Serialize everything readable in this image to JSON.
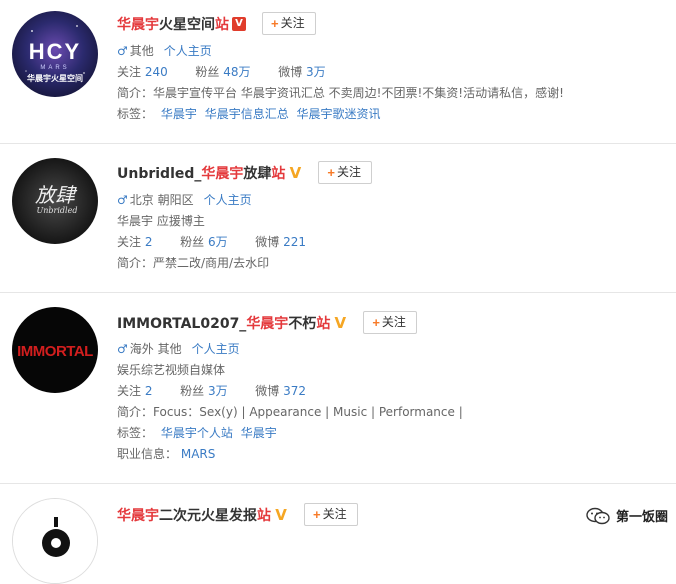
{
  "users": [
    {
      "name_prefix": "华晨宇",
      "name_middle": "火星空间",
      "name_suffix": "站",
      "verified": "red",
      "follow_label": "关注",
      "location": "其他",
      "home_link": "个人主页",
      "stats": {
        "follow_label": "关注",
        "follow": "240",
        "fans_label": "粉丝",
        "fans": "48万",
        "weibo_label": "微博",
        "weibo": "3万"
      },
      "bio_label": "简介：",
      "bio": "华晨宇宣传平台 华晨宇资讯汇总 不卖周边!不团票!不集资!活动请私信，感谢!",
      "tags_label": "标签：",
      "tags": [
        "华晨宇",
        "华晨宇信息汇总",
        "华晨宇歌迷资讯"
      ],
      "avatar_text": "HCY",
      "avatar_sub": "MARS",
      "avatar_caption": "华晨宇火星空间"
    },
    {
      "name_prefix": "Unbridled_",
      "name_highlight": "华晨宇",
      "name_middle": "放肆",
      "name_suffix": "站",
      "verified": "gold",
      "follow_label": "关注",
      "location": "北京 朝阳区",
      "home_link": "个人主页",
      "desc": "华晨宇 应援博主",
      "stats": {
        "follow_label": "关注",
        "follow": "2",
        "fans_label": "粉丝",
        "fans": "6万",
        "weibo_label": "微博",
        "weibo": "221"
      },
      "bio_label": "简介：",
      "bio": "严禁二改/商用/去水印",
      "avatar_text": "放肆",
      "avatar_sub": "Unbridled"
    },
    {
      "name_prefix": "IMMORTAL0207_",
      "name_highlight": "华晨宇",
      "name_middle": "不朽",
      "name_suffix": "站",
      "verified": "gold",
      "follow_label": "关注",
      "location": "海外 其他",
      "home_link": "个人主页",
      "desc": "娱乐综艺视频自媒体",
      "stats": {
        "follow_label": "关注",
        "follow": "2",
        "fans_label": "粉丝",
        "fans": "3万",
        "weibo_label": "微博",
        "weibo": "372"
      },
      "bio_label": "简介：",
      "bio": "Focus：Sex(y) | Appearance | Music | Performance |",
      "tags_label": "标签：",
      "tags": [
        "华晨宇个人站",
        "华晨宇"
      ],
      "job_label": "职业信息：",
      "job": "MARS",
      "avatar_text": "IMMORTAL"
    },
    {
      "name_prefix": "华晨宇",
      "name_middle": "二次元火星发报",
      "name_suffix": "站",
      "verified": "gold",
      "follow_label": "关注"
    }
  ],
  "watermark": "第一饭圈",
  "colors": {
    "highlight": "#e4393c",
    "link": "#3a7bc4",
    "follow_plus": "#f77b29"
  }
}
